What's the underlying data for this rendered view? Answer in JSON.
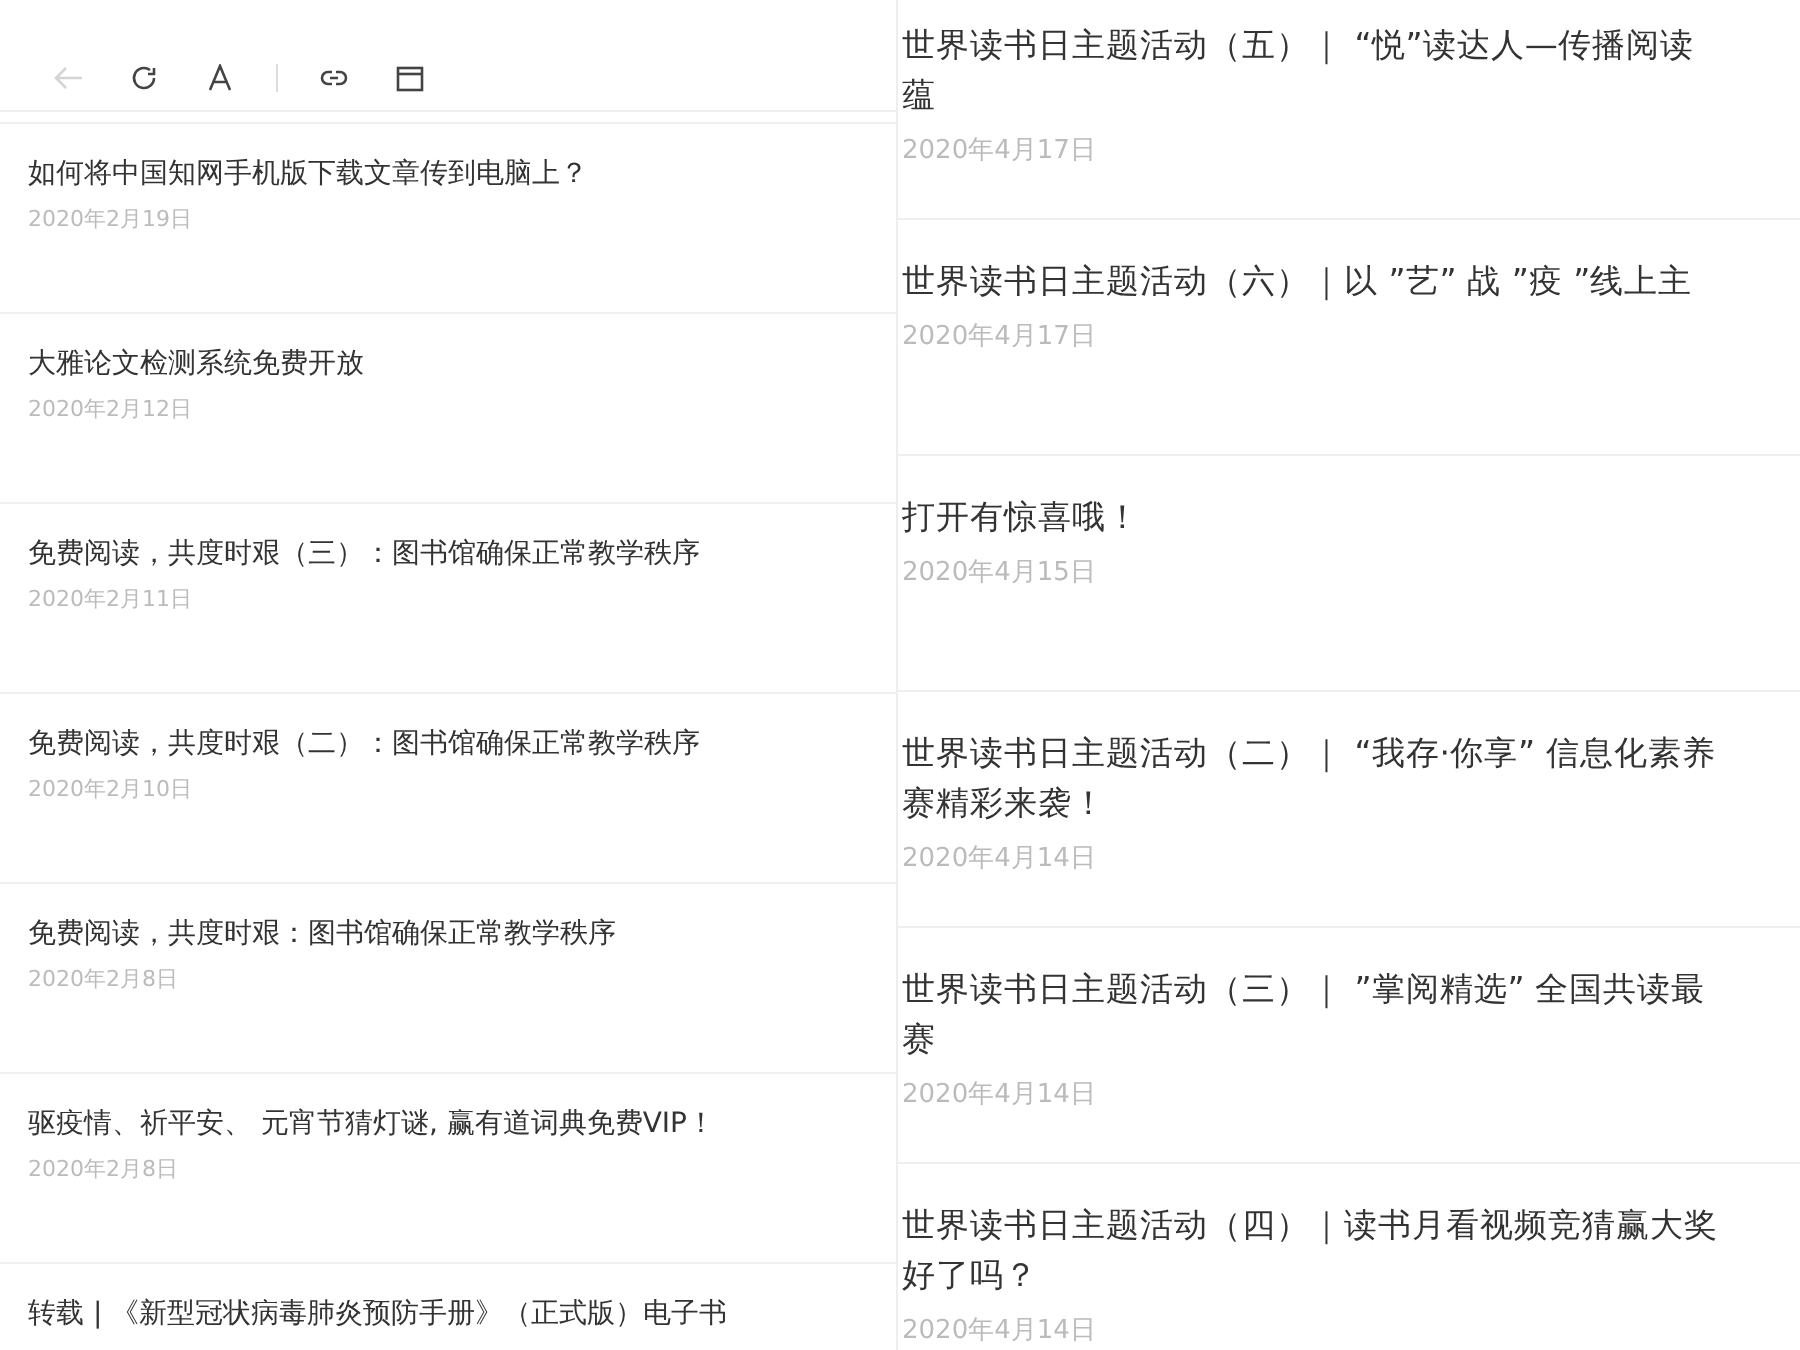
{
  "toolbar": {
    "buttons": [
      {
        "kind": "back",
        "disabled": true
      },
      {
        "kind": "refresh",
        "disabled": false
      },
      {
        "kind": "font",
        "disabled": false
      },
      {
        "kind": "divider"
      },
      {
        "kind": "link",
        "disabled": false
      },
      {
        "kind": "window",
        "disabled": false
      }
    ]
  },
  "left_list": [
    {
      "title": "如何将中国知网手机版下载文章传到电脑上？",
      "date": "2020年2月19日"
    },
    {
      "title": "大雅论文检测系统免费开放",
      "date": "2020年2月12日"
    },
    {
      "title": "免费阅读，共度时艰（三）：图书馆确保正常教学秩序",
      "date": "2020年2月11日"
    },
    {
      "title": "免费阅读，共度时艰（二）：图书馆确保正常教学秩序",
      "date": "2020年2月10日"
    },
    {
      "title": "免费阅读，共度时艰：图书馆确保正常教学秩序",
      "date": "2020年2月8日"
    },
    {
      "title": "驱疫情、祈平安、 元宵节猜灯谜, 赢有道词典免费VIP！",
      "date": "2020年2月8日"
    },
    {
      "title": "转载 | 《新型冠状病毒肺炎预防手册》（正式版）电子书"
    }
  ],
  "right_list": [
    {
      "title_lines": [
        "世界读书日主题活动（五）｜ “悦”读达人—传播阅读",
        "蕴"
      ],
      "date": "2020年4月17日"
    },
    {
      "title_lines": [
        "世界读书日主题活动（六）｜以 ”艺” 战 ”疫 ”线上主"
      ],
      "date": "2020年4月17日"
    },
    {
      "title_lines": [
        "打开有惊喜哦！"
      ],
      "date": "2020年4月15日"
    },
    {
      "title_lines": [
        "世界读书日主题活动（二）｜ “我存·你享” 信息化素养",
        "赛精彩来袭！"
      ],
      "date": "2020年4月14日"
    },
    {
      "title_lines": [
        "世界读书日主题活动（三）｜ ”掌阅精选” 全国共读最",
        "赛"
      ],
      "date": "2020年4月14日"
    },
    {
      "title_lines": [
        "世界读书日主题活动（四）｜读书月看视频竞猜赢大奖",
        "好了吗？"
      ],
      "date": "2020年4月14日"
    }
  ]
}
